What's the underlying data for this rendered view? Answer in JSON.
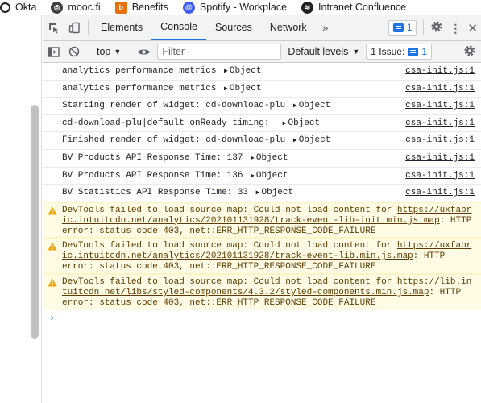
{
  "bookmarks": [
    {
      "label": "Okta",
      "icon": "okta-icon",
      "color": "#202124"
    },
    {
      "label": "mooc.fi",
      "icon": "globe-icon",
      "color": "#3c4043"
    },
    {
      "label": "Benefits",
      "icon": "benefits-icon",
      "color": "#e8710a"
    },
    {
      "label": "Spotify - Workplace",
      "icon": "workplace-icon",
      "color": "#3d5afe"
    },
    {
      "label": "Intranet Confluence",
      "icon": "spotify-icon",
      "color": "#202124"
    }
  ],
  "devtools": {
    "tabs": [
      "Elements",
      "Console",
      "Sources",
      "Network"
    ],
    "active_tab": "Console",
    "more_tabs": "»",
    "issues_badge_count": "1",
    "accent": "#1a73e8"
  },
  "toolbar": {
    "context": "top",
    "filter_placeholder": "Filter",
    "levels": "Default levels",
    "issues": "1 Issue:",
    "issues_count": "1"
  },
  "console": {
    "logs": [
      {
        "text": "analytics performance metrics ",
        "object": "Object",
        "source": "csa-init.js:1"
      },
      {
        "text": "analytics performance metrics ",
        "object": "Object",
        "source": "csa-init.js:1"
      },
      {
        "text": "Starting render of widget: cd-download-plu ",
        "object": "Object",
        "source": "csa-init.js:1"
      },
      {
        "text": "cd-download-plu|default onReady timing:  ",
        "object": "Object",
        "source": "csa-init.js:1"
      },
      {
        "text": "Finished render of widget: cd-download-plu ",
        "object": "Object",
        "source": "csa-init.js:1"
      },
      {
        "text": "BV Products API Response Time: 137 ",
        "object": "Object",
        "source": "csa-init.js:1"
      },
      {
        "text": "BV Products API Response Time: 136 ",
        "object": "Object",
        "source": "csa-init.js:1"
      },
      {
        "text": "BV Statistics API Response Time: 33 ",
        "object": "Object",
        "source": "csa-init.js:1"
      }
    ],
    "warnings": [
      {
        "prefix": "DevTools failed to load source map: Could not load content for ",
        "url": "https://uxfabric.intuitcdn.net/analytics/202101131928/track-event-lib-init.min.js.map",
        "suffix": ": HTTP error: status code 403, net::ERR_HTTP_RESPONSE_CODE_FAILURE"
      },
      {
        "prefix": "DevTools failed to load source map: Could not load content for ",
        "url": "https://uxfabric.intuitcdn.net/analytics/202101131928/track-event-lib.min.js.map",
        "suffix": ": HTTP error: status code 403, net::ERR_HTTP_RESPONSE_CODE_FAILURE"
      },
      {
        "prefix": "DevTools failed to load source map: Could not load content for ",
        "url": "https://lib.intuitcdn.net/libs/styled-components/4.3.2/styled-components.min.js.map",
        "suffix": ": HTTP error: status code 403, net::ERR_HTTP_RESPONSE_CODE_FAILURE"
      }
    ],
    "prompt": "›"
  }
}
